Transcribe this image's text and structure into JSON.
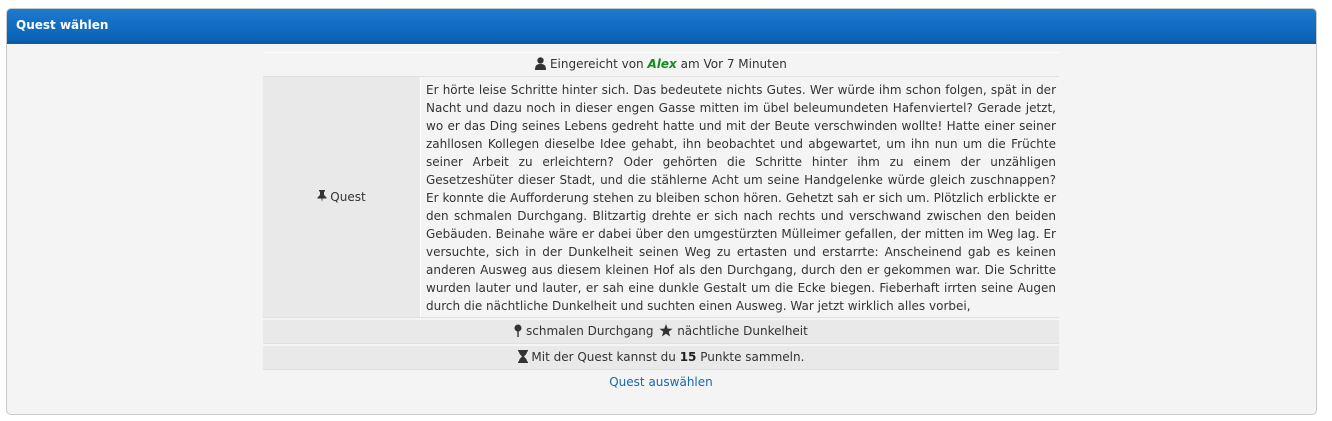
{
  "panel": {
    "title": "Quest wählen"
  },
  "submitted": {
    "prefix": "Eingereicht von",
    "author": "Alex",
    "suffix": "am Vor 7 Minuten",
    "icon": "user-icon"
  },
  "quest": {
    "label": "Quest",
    "icon": "pin-icon",
    "text": "Er hörte leise Schritte hinter sich. Das bedeutete nichts Gutes. Wer würde ihm schon folgen, spät in der Nacht und dazu noch in dieser engen Gasse mitten im übel beleumundeten Hafenviertel? Gerade jetzt, wo er das Ding seines Lebens gedreht hatte und mit der Beute verschwinden wollte! Hatte einer seiner zahllosen Kollegen dieselbe Idee gehabt, ihn beobachtet und abgewartet, um ihn nun um die Früchte seiner Arbeit zu erleichtern? Oder gehörten die Schritte hinter ihm zu einem der unzähligen Gesetzeshüter dieser Stadt, und die stählerne Acht um seine Handgelenke würde gleich zuschnappen? Er konnte die Aufforderung stehen zu bleiben schon hören. Gehetzt sah er sich um. Plötzlich erblickte er den schmalen Durchgang. Blitzartig drehte er sich nach rechts und verschwand zwischen den beiden Gebäuden. Beinahe wäre er dabei über den umgestürzten Mülleimer gefallen, der mitten im Weg lag. Er versuchte, sich in der Dunkelheit seinen Weg zu ertasten und erstarrte: Anscheinend gab es keinen anderen Ausweg aus diesem kleinen Hof als den Durchgang, durch den er gekommen war. Die Schritte wurden lauter und lauter, er sah eine dunkle Gestalt um die Ecke biegen. Fieberhaft irrten seine Augen durch die nächtliche Dunkelheit und suchten einen Ausweg. War jetzt wirklich alles vorbei,"
  },
  "tags": {
    "tag1": "schmalen Durchgang",
    "tag1_icon": "map-pin-icon",
    "tag2": "nächtliche Dunkelheit",
    "tag2_icon": "star-icon"
  },
  "points": {
    "prefix": "Mit der Quest kannst du",
    "value": "15",
    "suffix": "Punkte sammeln.",
    "icon": "hourglass-icon"
  },
  "action": {
    "choose_label": "Quest auswählen"
  }
}
